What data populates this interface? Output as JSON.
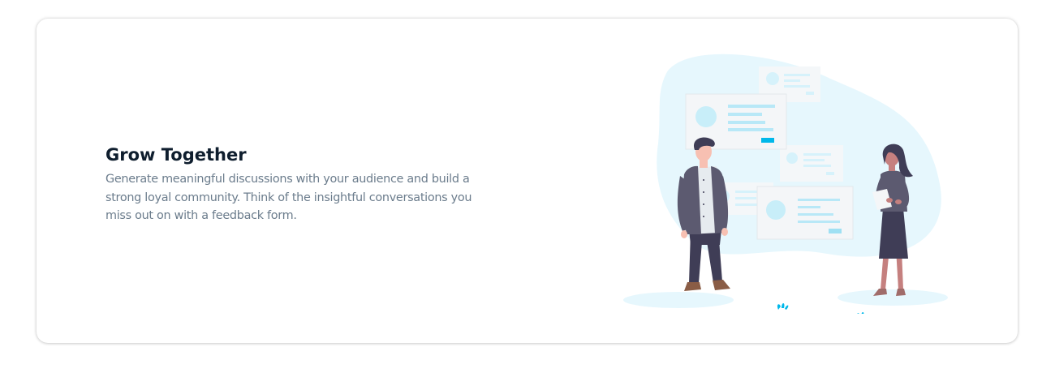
{
  "feature": {
    "title": "Grow Together",
    "description": "Generate meaningful discussions with your audience and build a strong loyal community. Think of the insightful conversations you miss out on with a feedback form."
  },
  "colors": {
    "title": "#0f1e2e",
    "body_text": "#6b7c8c",
    "accent": "#00b8ea",
    "blob": "#e6f7fd",
    "card_bg": "#ffffff"
  },
  "illustration": {
    "name": "two-people-discussion-illustration"
  }
}
